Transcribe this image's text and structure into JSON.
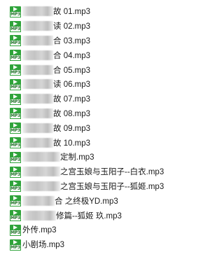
{
  "files": [
    {
      "name": "故 01.mp3",
      "icon": "mp3-file-icon"
    },
    {
      "name": "读 02.mp3",
      "icon": "mp3-file-icon"
    },
    {
      "name": "合 03.mp3",
      "icon": "mp3-file-icon"
    },
    {
      "name": "合 04.mp3",
      "icon": "mp3-file-icon"
    },
    {
      "name": "合 05.mp3",
      "icon": "mp3-file-icon"
    },
    {
      "name": "读 06.mp3",
      "icon": "mp3-file-icon"
    },
    {
      "name": "故 07.mp3",
      "icon": "mp3-file-icon"
    },
    {
      "name": "故 08.mp3",
      "icon": "mp3-file-icon"
    },
    {
      "name": "故 09.mp3",
      "icon": "mp3-file-icon"
    },
    {
      "name": "故 10.mp3",
      "icon": "mp3-file-icon"
    },
    {
      "name": "定制.mp3",
      "icon": "mp3-file-icon"
    },
    {
      "name": "之宫玉娘与玉阳子--白衣.mp3",
      "icon": "mp3-file-icon"
    },
    {
      "name": "之宫玉娘与玉阳子--狐姬.mp3",
      "icon": "mp3-file-icon"
    },
    {
      "name": "合 之终极YD.mp3",
      "icon": "mp3-file-icon"
    },
    {
      "name": "修篇--狐姬 玖.mp3",
      "icon": "mp3-file-icon"
    },
    {
      "name": "外传.mp3",
      "icon": "mp3-file-icon"
    },
    {
      "name": "小剧场.mp3",
      "icon": "mp3-file-icon"
    }
  ],
  "icon_label": "MP3",
  "colors": {
    "icon_green": "#2fa33a",
    "text": "#1a1a1a",
    "background": "#ffffff"
  }
}
